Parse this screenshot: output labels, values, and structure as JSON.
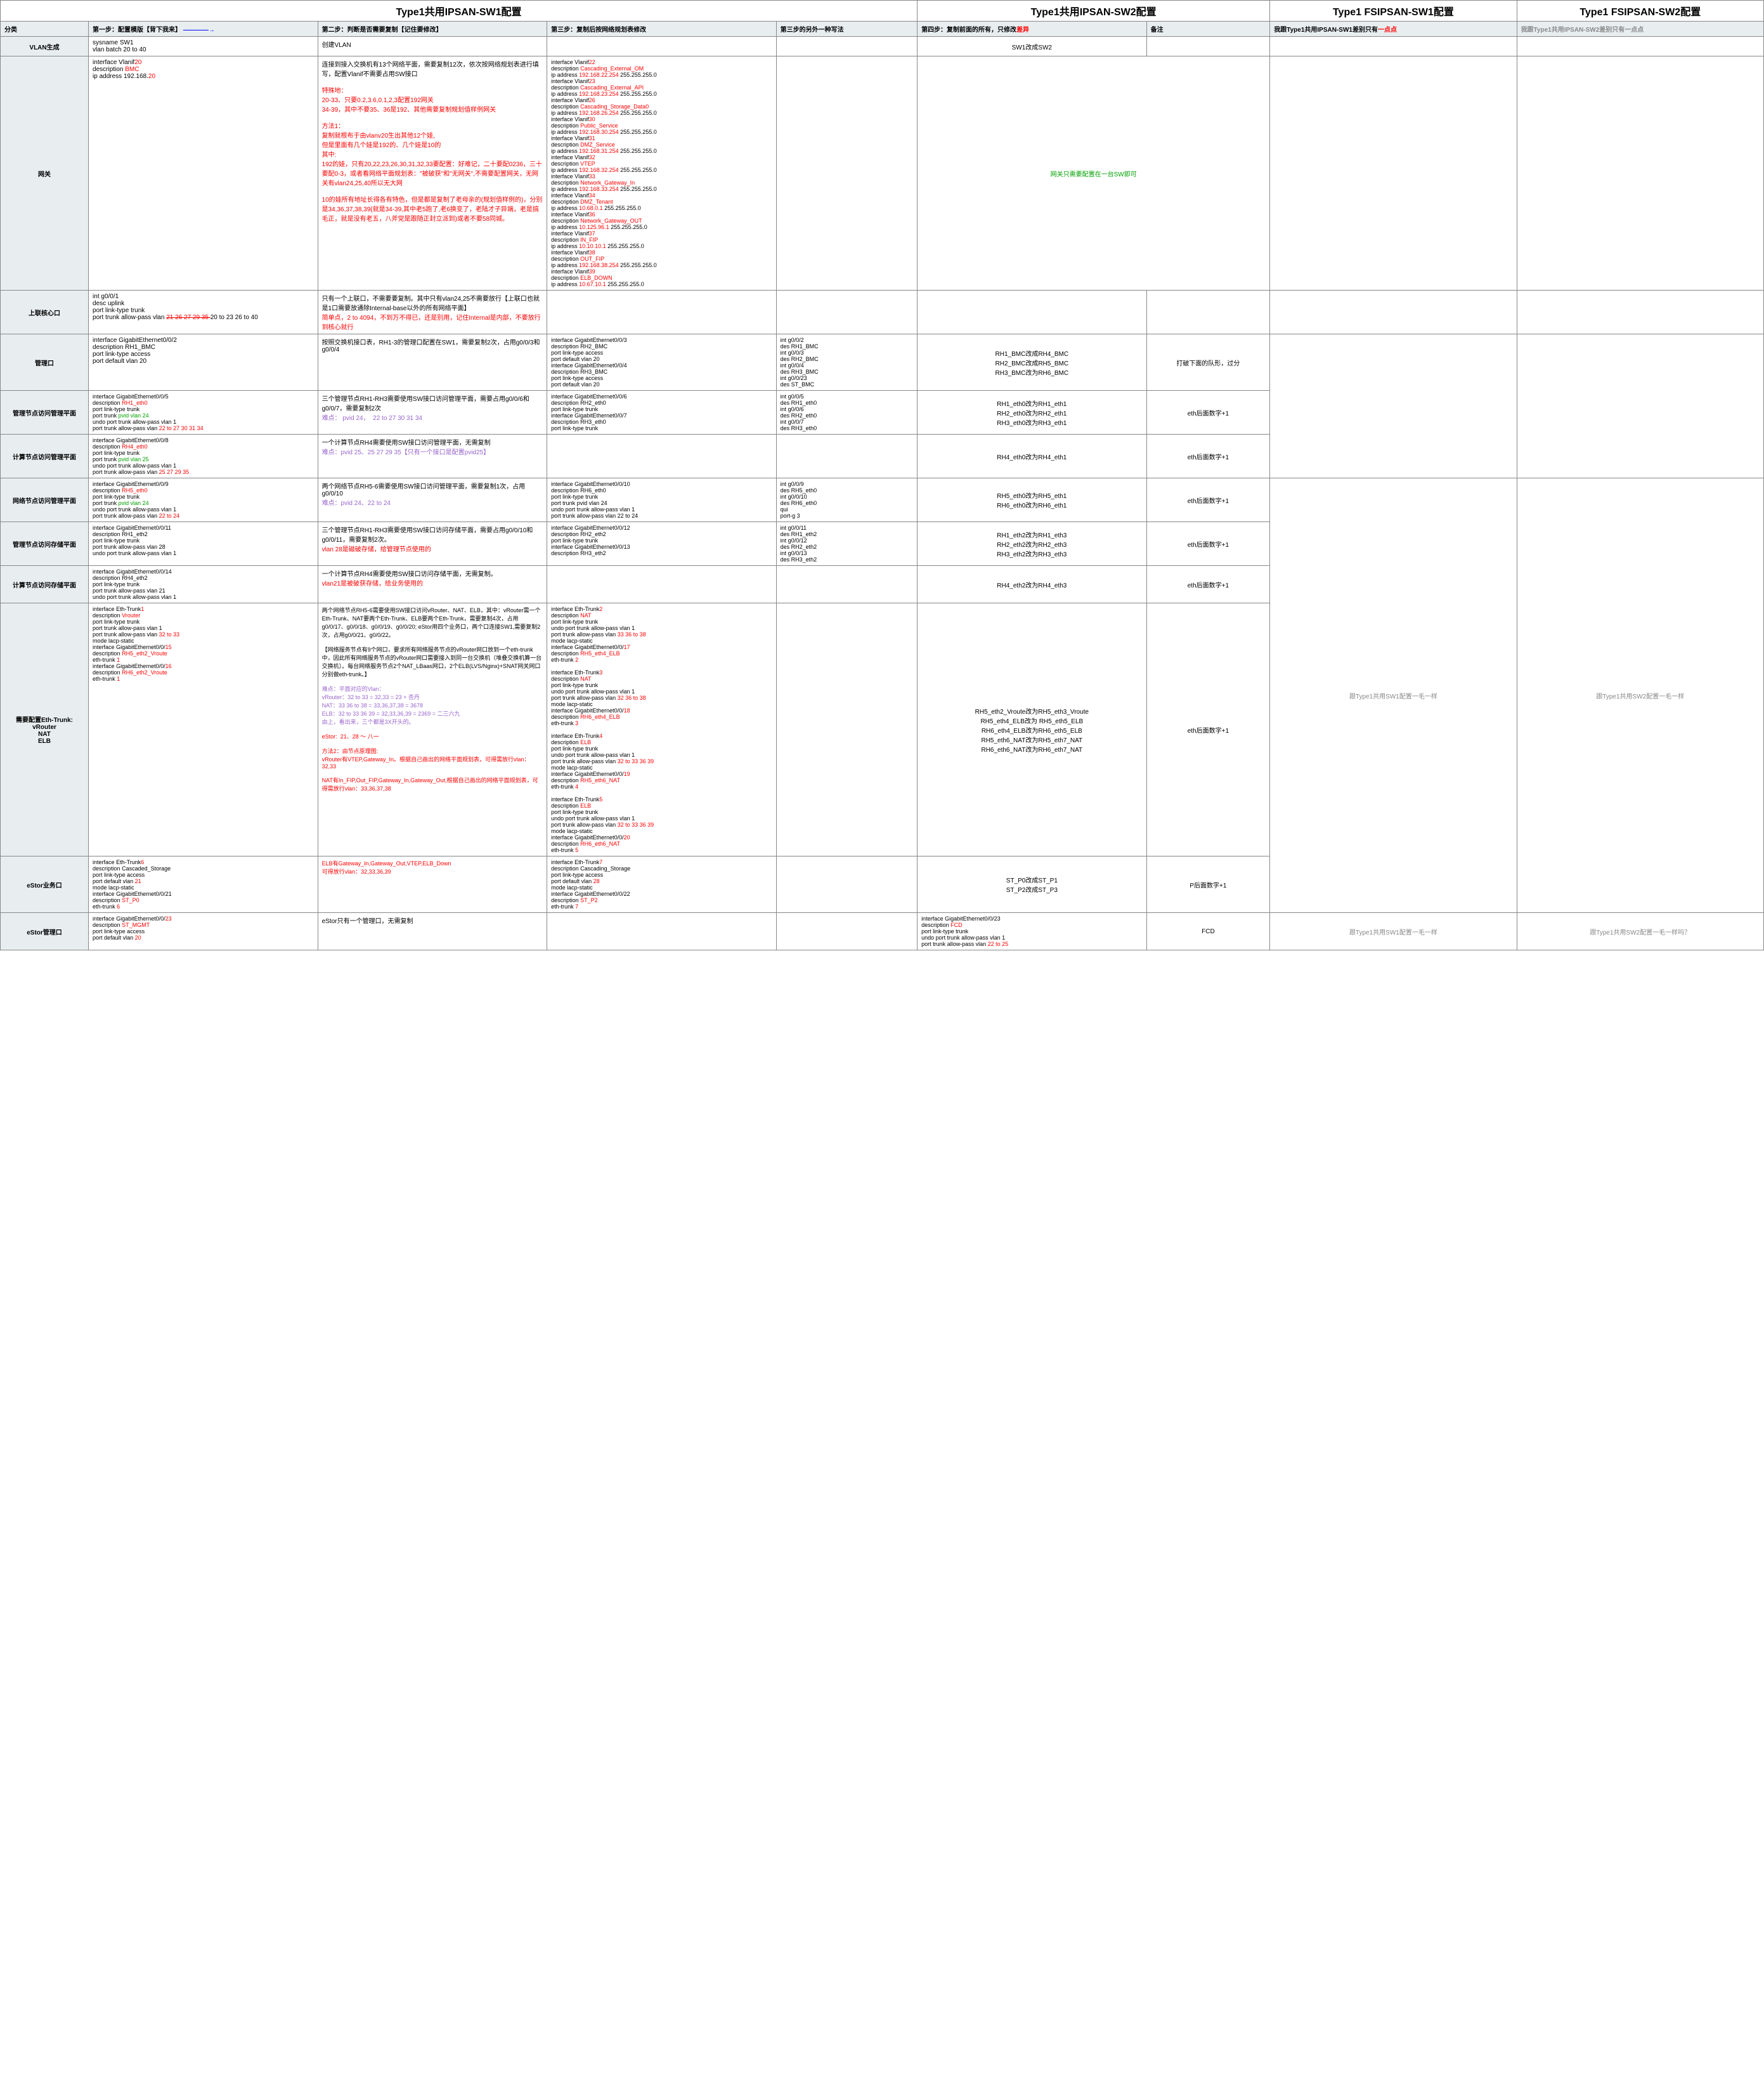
{
  "headers": {
    "c1": "Type1共用IPSAN-SW1配置",
    "c2": "Type1共用IPSAN-SW2配置",
    "c3": "Type1 FSIPSAN-SW1配置",
    "c4": "Type1 FSIPSAN-SW2配置"
  },
  "steps": {
    "cat": "分类",
    "s1a": "第一步：配置模版【背下我来】",
    "s1arrow": "————→",
    "s2": "第二步：判断是否需要复制【记住要修改】",
    "s3": "第三步：复制后按网络规划表修改",
    "s3b": "第三步的另外一种写法",
    "s4": "第四步：复制前面的所有，只修改",
    "s4diff": "差异",
    "beizhu": "备注",
    "c3note_a": "我跟Type1共用IPSAN-SW1差别只有",
    "c3note_b": "一点点",
    "c4note": "我跟Type1共用IPSAN-SW2差别只有一点点"
  },
  "vlan": {
    "cat": "VLAN生成",
    "a": "sysname SW1\nvlan batch 20 to 40",
    "b": "创建VLAN",
    "sw2": "SW1改成SW2"
  },
  "gw": {
    "cat": "网关",
    "a1": "interface Vlanif",
    "a1n": "20",
    "a2": "description ",
    "a2b": "BMC",
    "a3": "ip address 192.168.",
    "a3b": "20",
    ".a": ".254 255.255.255.0",
    "b_top": "连接到接入交换机有13个网络平面，需要复制12次，依次按网络规划表进行填写，配置Vlanif不需要占用SW接口",
    "b_red1": "特殊地：\n20-33、只要0.2,3.6,0.1,2,3配置192网关\n34-39，其中不要35、36是192、其他需要复制规划值样例网关",
    "b_red2": "方法1：\n复制就根布于由vlanv20生出其他12个娃,\n但是里面有几个娃是192的、几个娃是10的\n其中:\n192的娃，只有20,22,23,26,30,31,32,33要配置：好难记，二十要配0236，三十要配0-3，或者看网络平面规划表：\"被破获\"和\"无网关\",不需要配置网关，无网关有vlan24,25,40所以无大网",
    "b_red3": "10的娃所有地址长得各有特色，但是都是复制了老母亲的(规划值样例的)，分别是34,36,37,38,39(就是34-39,其中老5跑了,老6换变了，老陆才子异端，老是搞毛正，就是没有老五，八斧党是跟随正封立派到)或者不要58同城。",
    "iface": [
      {
        "n": "22",
        "d": "Cascading_External_OM",
        "ip": "192.168.22.254 255.255.255.0"
      },
      {
        "n": "23",
        "d": "Cascading_External_API",
        "ip": "192.168.23.254 255.255.255.0"
      },
      {
        "n": "26",
        "d": "Cascading_Storage_Data0",
        "ip": "192.168.26.254 255.255.255.0"
      },
      {
        "n": "30",
        "d": "Public_Service",
        "ip": "192.168.30.254 255.255.255.0"
      },
      {
        "n": "31",
        "d": "DMZ_Service",
        "ip": "192.168.31.254 255.255.255.0"
      },
      {
        "n": "32",
        "d": "VTEP",
        "ip": "192.168.32.254 255.255.255.0"
      },
      {
        "n": "33",
        "d": "Network_Gateway_In",
        "ip": "192.168.33.254 255.255.255.0"
      },
      {
        "n": "34",
        "d": "DMZ_Tenant",
        "ip": "10.68.0.1 255.255.255.0"
      },
      {
        "n": "36",
        "d": "Network_Gateway_OUT",
        "ip": "10.125.96.1 255.255.255.0"
      },
      {
        "n": "37",
        "d": "IN_FIP",
        "ip": "10.10.10.1 255.255.255.0"
      },
      {
        "n": "38",
        "d": "OUT_FIP",
        "ip": "192.168.38.254 255.255.255.0"
      },
      {
        "n": "39",
        "d": "ELB_DOWN",
        "ip": "10.67.10.1 255.255.255.0"
      }
    ],
    "gw_note": "网关只需要配置在一台SW即可"
  },
  "uplink": {
    "cat": "上联核心口",
    "a": "int g0/0/1\ndesc uplink\nport link-type trunk\nport trunk allow-pass vlan ",
    "a_strike": "21 26 27 29 35 ",
    "a_end": "20 to 23 26 to 40",
    "b": "只有一个上联口，不需要要复制。其中只有vlan24,25不需要放行【上联口也就是1口需要放通除Internal-base以外的所有网络平面】\n",
    "b_red": "简单点，2 to 4094，不到万不得已，还是别用，记住Internal是内部，不要放行到核心就行"
  },
  "mgmt": {
    "cat": "管理口",
    "a": "interface GigabitEthernet0/0/2\ndescription RH1_BMC\nport link-type access\nport default vlan 20",
    "b": "按照交换机接口表，RH1-3的管理口配置在SW1，需要复制2次，占用g0/0/3和g0/0/4",
    "c": "interface GigabitEthernet0/0/3\ndescription RH2_BMC\nport link-type access\nport default vlan 20\ninterface GigabitEthernet0/0/4\ndescription RH3_BMC\nport link-type access\nport default vlan 20",
    "c2": "int g0/0/2\ndes RH1_BMC\nint g0/0/3\ndes RH2_BMC\nint g0/0/4\ndes RH3_BMC\nint g0/0/23\ndes ST_BMC",
    "sw2": "RH1_BMC改成RH4_BMC\nRH2_BMC改成RH5_BMC\nRH3_BMC改为RH6_BMC",
    "bz": "打破下面的队形，过分"
  },
  "mgplane": {
    "cat": "管理节点访问管理平面",
    "a": "interface GigabitEthernet0/0/5\ndescription RH1_eth0\nport link-type trunk\nport trunk pvid vlan 24\nundo port trunk allow-pass vlan 1\nport trunk allow-pass vlan 22 to 27 30 31 34",
    "b": "三个管理节点RH1-RH3需要使用SW接口访问管理平面，需要占用g0/0/6和g0/0/7，需要复制2次\n",
    "b_p": "难点： pvid 24，  22 to 27 30 31 34",
    "c": "interface GigabitEthernet0/0/6\ndescription RH2_eth0\nport link-type trunk\ninterface GigabitEthernet0/0/7\ndescription RH3_eth0\nport link-type trunk",
    "c2": "int g0/0/5\ndes RH1_eth0\nint g0/0/6\ndes RH2_eth0\nint g0/0/7\ndes RH3_eth0",
    "sw2": "RH1_eth0改为RH1_eth1\nRH2_eth0改为RH2_eth1\nRH3_eth0改为RH3_eth1",
    "bz": "eth后面数字+1"
  },
  "comp_mgmt": {
    "cat": "计算节点访问管理平面",
    "a": "interface GigabitEthernet0/0/8\ndescription RH4_eth0\nport link-type trunk\nport trunk pvid vlan 25\nundo port trunk allow-pass vlan 1\nport trunk allow-pass vlan 25 27 29 35",
    "b": "一个计算节点RH4需要使用SW接口访问管理平面，无需复制\n",
    "b_p": "难点：pvid 25、25 27 29 35【只有一个接口是配置pvid25】",
    "sw2": "RH4_eth0改为RH4_eth1",
    "bz": "eth后面数字+1",
    "fs1": "跟Type1共用SW1配置一毛一样",
    "fs2": "跟Type1共用SW2配置一毛一样"
  },
  "net_mgmt": {
    "cat": "网络节点访问管理平面",
    "a": "interface GigabitEthernet0/0/9\ndescription RH5_eth0\nport link-type trunk\nport trunk pvid vlan 24\nundo port trunk allow-pass vlan 1\nport trunk allow-pass vlan 22 to 24",
    "b": "两个网络节点RH5-6需要使用SW接口访问管理平面，需要复制1次，占用g0/0/10\n",
    "b_p": "难点：pvid 24、22 to 24",
    "c": "interface GigabitEthernet0/0/10\ndescription RH6_eth0\nport link-type trunk\nport trunk pvid vlan 24\nundo port trunk allow-pass vlan 1\nport trunk allow-pass vlan 22 to 24",
    "c2": "int g0/0/9\ndes RH5_eth0\nint g0/0/10\ndes RH6_eth0\nqui\nport-g 3",
    "sw2": "RH5_eth0改为RH5_eth1\nRH6_eth0改为RH6_eth1",
    "bz": "eth后面数字+1"
  },
  "mg_stor": {
    "cat": "管理节点访问存储平面",
    "a": "interface GigabitEthernet0/0/11\ndescription RH1_eth2\nport link-type trunk\nport trunk allow-pass vlan 28\nundo port trunk allow-pass vlan 1",
    "b": "三个管理节点RH1-RH3需要使用SW接口访问存储平面，需要占用g0/0/10和g0/0/11，需要复制2次。\n",
    "b_r": "vlan 28是磁破存储，给管理节点使用的",
    "c": "interface GigabitEthernet0/0/12\ndescription RH2_eth2\nport link-type trunk\ninterface GigabitEthernet0/0/13\ndescription RH3_eth2",
    "c2": "int g0/0/11\ndes RH1_eth2\nint g0/0/12\ndes RH2_eth2\nint g0/0/13\ndes RH3_eth2",
    "sw2": "RH1_eth2改为RH1_eth3\nRH2_eth2改为RH2_eth3\nRH3_eth2改为RH3_eth3",
    "bz": "eth后面数字+1"
  },
  "comp_stor": {
    "cat": "计算节点访问存储平面",
    "a": "interface GigabitEthernet0/0/14\ndescription RH4_eth2\nport link-type trunk\nport trunk allow-pass vlan 21\nundo port trunk allow-pass vlan 1",
    "b": "一个计算节点RH4需要使用SW接口访问存储平面，无需复制。\n",
    "b_r": "vlan21是被破获存储，给业务使用的",
    "sw2": "RH4_eth2改为RH4_eth3",
    "bz": "eth后面数字+1"
  },
  "eth_trunk": {
    "cat": "需要配置Eth-Trunk:\nvRouter\nNAT\nELB",
    "a": "interface Eth-Trunk1\ndescription Vrouter\nport link-type trunk\nport trunk allow-pass vlan 1\nport trunk allow-pass vlan 32 to 33\nmode lacp-static\ninterface GigabitEthernet0/0/15\ndescription RH5_eth2_Vroute\neth-trunk 1\ninterface GigabitEthernet0/0/16\ndescription RH6_eth2_Vroute\neth-trunk 1",
    "b_top": "两个网络节点RH5-6需要使用SW接口访问vRouter、NAT、ELB，其中：vRouter需一个Eth-Trunk、NAT要两个Eth-Trunk、ELB要两个Eth-Trunk，需要复制4次，占用g0/0/17、g0/0/18、g0/0/19、g0/0/20; eStor用四个业务口，两个口连接SW1,需要复制2次，占用g0/0/21、g0/0/22。",
    "b_mid": "【网络服务节点有9个网口，要求所有网络服务节点的vRouter网口放到一个eth-trunk中，因此所有网络服务节点的vRouter网口需要接入到同一台交换机（堆叠交换机算一台交换机）。每台网络服务节点2个NAT_LBaas网口，2个ELB(LVS/Nginx)+SNAT网关网口分别做eth-trunk。】",
    "b_hard": "难点：平面对应的Vlan：\nvRouter：32 to 33 = 32,33 = 23 + 否丹\nNAT：33 36 to 38 = 33,36,37,38 = 3678\nELB：32 to 33 36 39 = 32,33,36,39 = 2369 = 二三六九\n由上，看出来，三个都是3X开头的。",
    "b_estor": "eStor:  21、28 ～ 八一",
    "b_m2": "方法2：由节点原理图:\nvRouter有VTEP,Gateway_In。根据自己画出的网络平面规划表，可得需放行vlan：32,33\n\nNAT有In_FIP,Out_FIP,Gateway_In,Gateway_Out,根据自己画出的网络平面规划表，可得需放行vlan：33,36,37,38",
    "c": "interface Eth-Trunk2\ndescription NAT\nport link-type trunk\nundo port trunk allow-pass vlan 1\nport trunk allow-pass vlan 33 36 to 38\nmode lacp-static\ninterface GigabitEthernet0/0/17\ndescription RH5_eth4_ELB\neth-trunk 2\n\ninterface Eth-Trunk3\ndescription NAT\nport link-type trunk\nundo port trunk allow-pass vlan 1\nport trunk allow-pass vlan 32 36 to 38\nmode lacp-static\ninterface GigabitEthernet0/0/18\ndescription RH6_eth4_ELB\neth-trunk 3\n\ninterface Eth-Trunk4\ndescription ELB\nport link-type trunk\nundo port trunk allow-pass vlan 1\nport trunk allow-pass vlan 32 to 33 36 39\nmode lacp-static\ninterface GigabitEthernet0/0/19\ndescription RH5_eth6_NAT\neth-trunk 4\n\ninterface Eth-Trunk5\ndescription ELB\nport link-type trunk\nundo port trunk allow-pass vlan 1\nport trunk allow-pass vlan 32 to 33 36 39\nmode lacp-static\ninterface GigabitEthernet0/0/20\ndescription RH6_eth6_NAT\neth-trunk 5",
    "sw2": "RH5_eth2_Vroute改为RH5_eth3_Vroute\nRH5_eth4_ELB改为 RH5_eth5_ELB\nRH6_eth4_ELB改为RH6_eth5_ELB\nRH5_eth6_NAT改为RH5_eth7_NAT\nRH6_eth6_NAT改为RH6_eth7_NAT",
    "bz": "eth后面数字+1"
  },
  "estor_biz": {
    "cat": "eStor业务口",
    "a": "interface Eth-Trunk6\ndescription Cascaded_Storage\nport link-type access\nport default vlan 21\nmode lacp-static\ninterface GigabitEthernet0/0/21\ndescription ST_P0\neth-trunk 6",
    "b": "ELB有Gateway_In,Gateway_Out,VTEP,ELB_Down\n可得放行vlan：32,33,36,39",
    "c": "interface Eth-Trunk7\ndescription Cascading_Storage\nport link-type access\nport default vlan 28\nmode lacp-static\ninterface GigabitEthernet0/0/22\ndescription ST_P2\neth-trunk 7",
    "sw2": "ST_P0改成ST_P1\nST_P2改成ST_P3",
    "bz": "P后面数字+1"
  },
  "estor_mgmt": {
    "cat": "eStor管理口",
    "a": "interface GigabitEthernet0/0/23\ndescription ST_MGMT\nport link-type access\nport default vlan 20",
    "b": "eStor只有一个管理口，无需复制",
    "sw2": "interface GigabitEthernet0/0/23\ndescription FCD\nport link-type trunk\nundo port trunk allow-pass vlan 1\nport trunk allow-pass vlan 22 to 25",
    "bz": "FCD",
    "fs1": "跟Type1共用SW1配置一毛一样",
    "fs2": "跟Type1共用SW2配置一毛一样吗？"
  }
}
